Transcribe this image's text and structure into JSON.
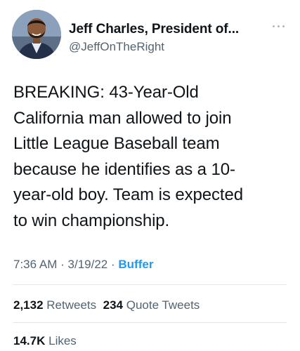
{
  "author": {
    "display_name": "Jeff Charles, President of...",
    "handle": "@JeffOnTheRight",
    "avatar_icon": "profile-photo"
  },
  "more_icon": "ellipsis-icon",
  "tweet": {
    "lines": [
      "BREAKING: 43-Year-Old",
      "California man allowed to join",
      "Little League Baseball team",
      "because he identifies as a 10-",
      "year-old boy. Team is expected",
      "to win championship."
    ]
  },
  "meta": {
    "time": "7:36 AM",
    "separator": "·",
    "date": "3/19/22",
    "source": "Buffer"
  },
  "stats": {
    "retweets_count": "2,132",
    "retweets_label": "Retweets",
    "quotes_count": "234",
    "quotes_label": "Quote Tweets",
    "likes_count": "14.7K",
    "likes_label": "Likes"
  },
  "colors": {
    "link_blue": "#1d9bf0",
    "secondary_text": "#536471",
    "primary_text": "#0f1419",
    "divider": "#e1e8ed"
  }
}
